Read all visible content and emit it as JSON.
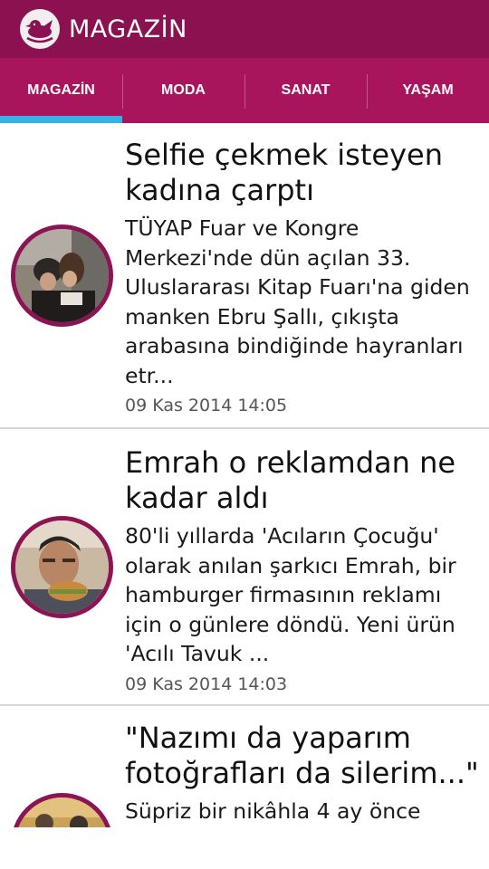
{
  "app_bar": {
    "title": "MAGAZİN",
    "logo_icon": "bird-logo-icon"
  },
  "tabs": [
    {
      "label": "MAGAZİN",
      "selected": true
    },
    {
      "label": "MODA",
      "selected": false
    },
    {
      "label": "SANAT",
      "selected": false
    },
    {
      "label": "YAŞAM",
      "selected": false
    }
  ],
  "colors": {
    "app_bar": "#8c1150",
    "tab_bar": "#a8155c",
    "tab_indicator": "#36b3e6",
    "thumb_ring": "#8d1454"
  },
  "articles": [
    {
      "headline": "Selfie çekmek isteyen kadına çarptı",
      "summary": "TÜYAP Fuar ve Kongre Merkezi'nde dün açılan 33. Uluslararası Kitap Fuarı'na giden manken Ebru Şallı, çıkışta arabasına bindiğinde hayranları etr...",
      "date": "09 Kas 2014 14:05"
    },
    {
      "headline": "Emrah o reklamdan ne kadar aldı",
      "summary": "80'li yıllarda 'Acıların Çocuğu' olarak anılan şarkıcı Emrah, bir hamburger firmasının reklamı için o günlere döndü. Yeni ürün 'Acılı Tavuk ...",
      "date": "09 Kas 2014 14:03"
    },
    {
      "headline": "\"Nazımı da yaparım fotoğrafları da silerim...\"",
      "summary": "Süpriz bir nikâhla 4 ay önce"
    }
  ]
}
